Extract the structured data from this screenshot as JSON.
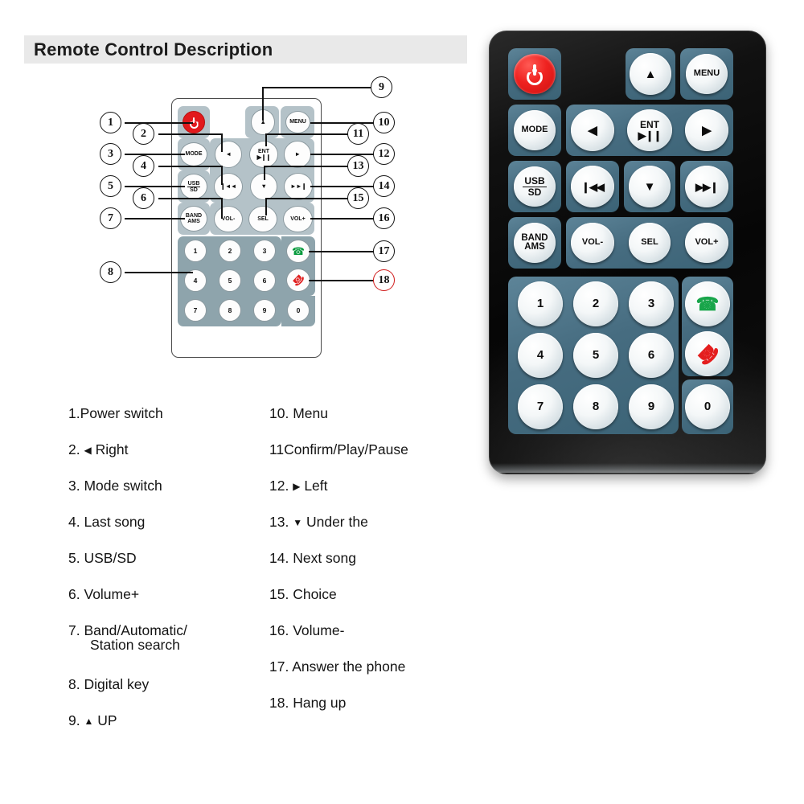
{
  "header": {
    "title": "Remote Control Description"
  },
  "diagram": {
    "buttons": {
      "power": "power-icon",
      "mode": "MODE",
      "usb_top": "USB",
      "usb_bottom": "SD",
      "band_top": "BAND",
      "band_bottom": "AMS",
      "menu": "MENU",
      "up": "▲",
      "down": "▼",
      "left": "◄",
      "right": "►",
      "ent_top": "ENT",
      "ent_bottom": "▶❙❙",
      "prev": "❙◄◄",
      "next": "►►❙",
      "vol_down": "VOL-",
      "sel": "SEL",
      "vol_up": "VOL+",
      "answer": "answer-call-icon",
      "hangup": "hang-up-icon"
    },
    "keypad": [
      "1",
      "2",
      "3",
      "4",
      "5",
      "6",
      "7",
      "8",
      "9",
      "0"
    ],
    "callouts": [
      "1",
      "2",
      "3",
      "4",
      "5",
      "6",
      "7",
      "8",
      "9",
      "10",
      "11",
      "12",
      "13",
      "14",
      "15",
      "16",
      "17",
      "18"
    ],
    "callout_highlight_color": "#d01a1a"
  },
  "legend": {
    "left": [
      {
        "num": "1.",
        "text": "Power switch",
        "glyph": ""
      },
      {
        "num": "2.",
        "text": "Right",
        "glyph": "◀"
      },
      {
        "num": "3.",
        "text": "Mode switch",
        "glyph": ""
      },
      {
        "num": "4.",
        "text": "Last song",
        "glyph": ""
      },
      {
        "num": "5.",
        "text": "USB/SD",
        "glyph": ""
      },
      {
        "num": "6.",
        "text": "Volume+",
        "glyph": ""
      },
      {
        "num": "7.",
        "text": "Band/Automatic/",
        "glyph": "",
        "line2": "Station search"
      },
      {
        "num": "8.",
        "text": "Digital key",
        "glyph": ""
      },
      {
        "num": "9.",
        "text": "UP",
        "glyph": "▲"
      }
    ],
    "right": [
      {
        "num": "10.",
        "text": "Menu",
        "glyph": ""
      },
      {
        "num": "11",
        "text": "Confirm/Play/Pause",
        "glyph": ""
      },
      {
        "num": "12.",
        "text": "Left",
        "glyph": "▶"
      },
      {
        "num": "13.",
        "text": "Under the",
        "glyph": "▼"
      },
      {
        "num": "14.",
        "text": "Next song",
        "glyph": ""
      },
      {
        "num": "15.",
        "text": "Choice",
        "glyph": ""
      },
      {
        "num": "16.",
        "text": "Volume-",
        "glyph": ""
      },
      {
        "num": "17.",
        "text": "Answer the phone",
        "glyph": ""
      },
      {
        "num": "18.",
        "text": "Hang up",
        "glyph": ""
      }
    ]
  },
  "photo": {
    "buttons": {
      "power": "power-icon",
      "mode": "MODE",
      "usb_top": "USB",
      "usb_bottom": "SD",
      "band_top": "BAND",
      "band_bottom": "AMS",
      "menu": "MENU",
      "up": "▲",
      "down": "▼",
      "left": "◀",
      "right": "▶",
      "ent_top": "ENT",
      "ent_bottom": "▶❙❙",
      "prev": "❙◀◀",
      "next": "▶▶❙",
      "vol_down": "VOL-",
      "sel": "SEL",
      "vol_up": "VOL+",
      "answer": "answer-call-icon",
      "hangup": "hang-up-icon"
    },
    "keypad": [
      "1",
      "2",
      "3",
      "4",
      "5",
      "6",
      "7",
      "8",
      "9",
      "0"
    ]
  },
  "colors": {
    "header_band": "#e9e9e9",
    "power_red": "#e2191c",
    "pad_gray": "#b4c2c8",
    "keypad_gray": "#8ea4ac",
    "photo_pad_teal": "#466c80",
    "photo_body_black": "#0b0b0b",
    "answer_green": "#18a54a",
    "hangup_red": "#e41e1e"
  }
}
